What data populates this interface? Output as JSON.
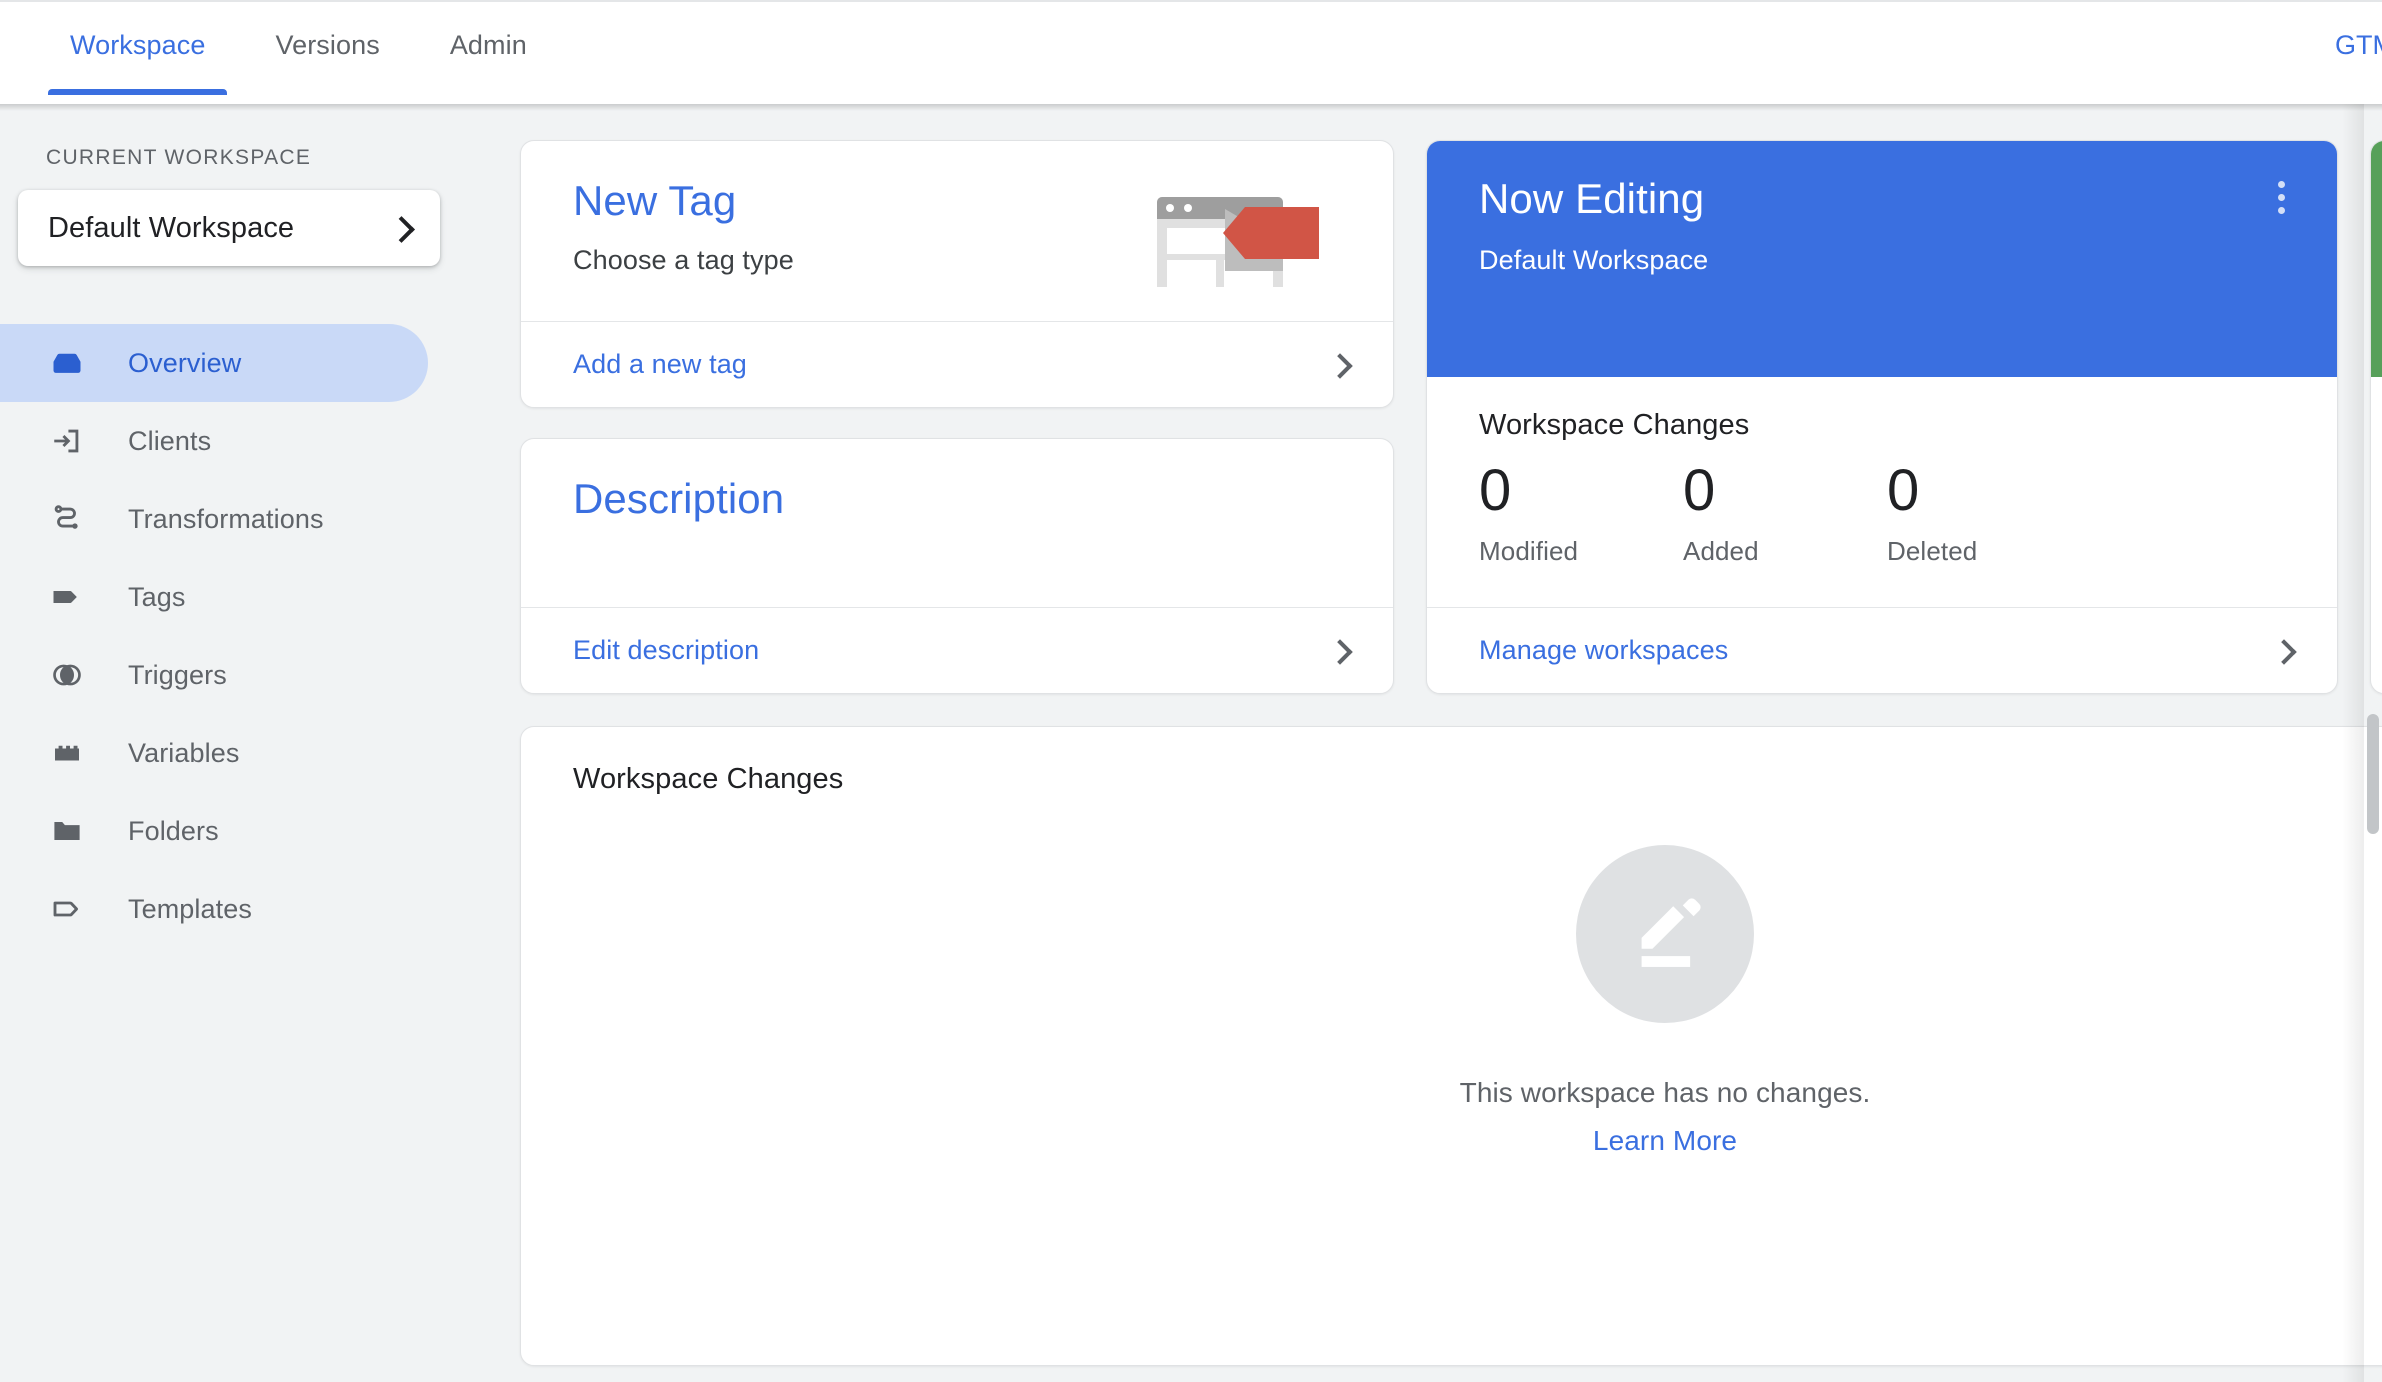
{
  "topbar": {
    "tabs": [
      {
        "label": "Workspace",
        "active": true
      },
      {
        "label": "Versions",
        "active": false
      },
      {
        "label": "Admin",
        "active": false
      }
    ],
    "container_id": "GTM-"
  },
  "sidebar": {
    "section_label": "CURRENT WORKSPACE",
    "workspace_selector": {
      "name": "Default Workspace",
      "chevron_icon": "chevron-right-icon"
    },
    "items": [
      {
        "label": "Overview",
        "icon": "overview-box-icon",
        "active": true
      },
      {
        "label": "Clients",
        "icon": "clients-arrow-in-box-icon",
        "active": false
      },
      {
        "label": "Transformations",
        "icon": "transformations-node-icon",
        "active": false
      },
      {
        "label": "Tags",
        "icon": "tag-filled-icon",
        "active": false
      },
      {
        "label": "Triggers",
        "icon": "triggers-circles-icon",
        "active": false
      },
      {
        "label": "Variables",
        "icon": "variables-brick-icon",
        "active": false
      },
      {
        "label": "Folders",
        "icon": "folder-filled-icon",
        "active": false
      },
      {
        "label": "Templates",
        "icon": "template-tag-outline-icon",
        "active": false
      }
    ]
  },
  "new_tag_card": {
    "title": "New Tag",
    "subtitle": "Choose a tag type",
    "illustration": "browser-window-with-tag-illustration",
    "footer_link": "Add a new tag",
    "footer_chevron": "chevron-right-icon"
  },
  "description_card": {
    "title": "Description",
    "body": "",
    "footer_link": "Edit description",
    "footer_chevron": "chevron-right-icon"
  },
  "now_editing_card": {
    "title": "Now Editing",
    "workspace_name": "Default Workspace",
    "menu_icon": "more-vert-icon",
    "changes_title": "Workspace Changes",
    "stats": [
      {
        "value": "0",
        "label": "Modified"
      },
      {
        "value": "0",
        "label": "Added"
      },
      {
        "value": "0",
        "label": "Deleted"
      }
    ],
    "footer_link": "Manage workspaces",
    "footer_chevron": "chevron-right-icon"
  },
  "workspace_changes_panel": {
    "title": "Workspace Changes",
    "empty_icon": "edit-pencil-icon",
    "empty_text": "This workspace has no changes.",
    "empty_link": "Learn More"
  },
  "colors": {
    "accent_blue": "#3a6fe0",
    "active_pill": "#c9d9f7",
    "page_bg": "#f1f3f4",
    "green_card": "#57a05a",
    "tag_red": "#d15546",
    "text_primary": "#202124",
    "text_secondary": "#5f6368"
  }
}
